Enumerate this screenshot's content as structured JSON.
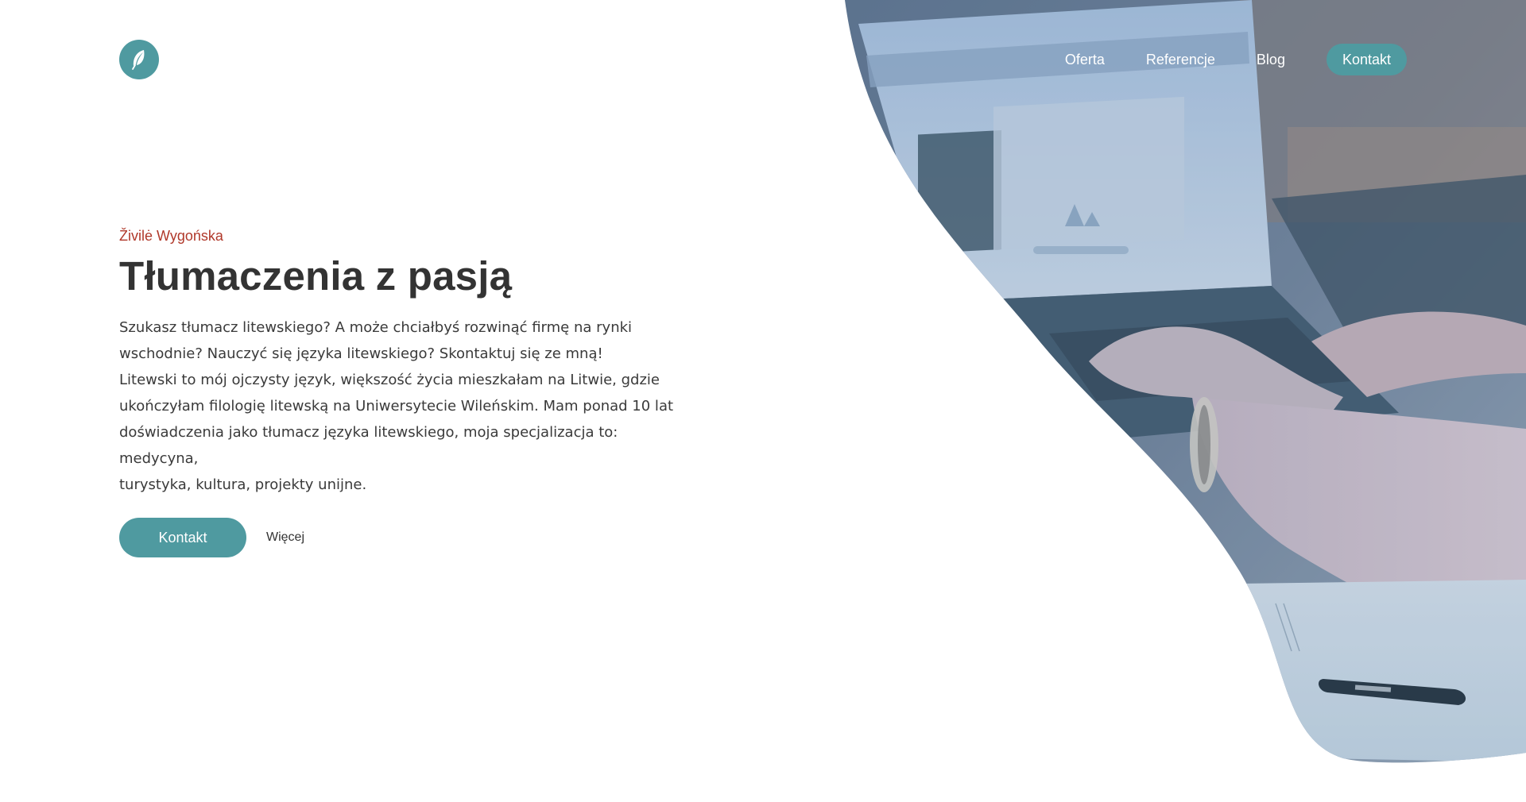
{
  "nav": {
    "items": [
      "Oferta",
      "Referencje",
      "Blog"
    ],
    "cta_label": "Kontakt"
  },
  "hero": {
    "eyebrow": "Živilė Wygońska",
    "headline": "Tłumaczenia z pasją",
    "paragraph_lines": [
      "Szukasz tłumacz litewskiego? A może chciałbyś rozwinąć firmę na rynki",
      "wschodnie? Nauczyć się języka litewskiego? Skontaktuj się ze mną!",
      "Litewski to mój ojczysty język, większość życia mieszkałam na Litwie, gdzie",
      "ukończyłam filologię litewską na Uniwersytecie Wileńskim. Mam ponad 10 lat",
      "doświadczenia jako tłumacz języka litewskiego, moja specjalizacja to: medycyna,",
      "turystyka, kultura, projekty unijne."
    ],
    "primary_button": "Kontakt",
    "secondary_link": "Więcej"
  },
  "icons": {
    "logo": "feather-icon"
  },
  "colors": {
    "accent": "#4f9aa0",
    "eyebrow": "#b0382a",
    "heading": "#333333"
  }
}
